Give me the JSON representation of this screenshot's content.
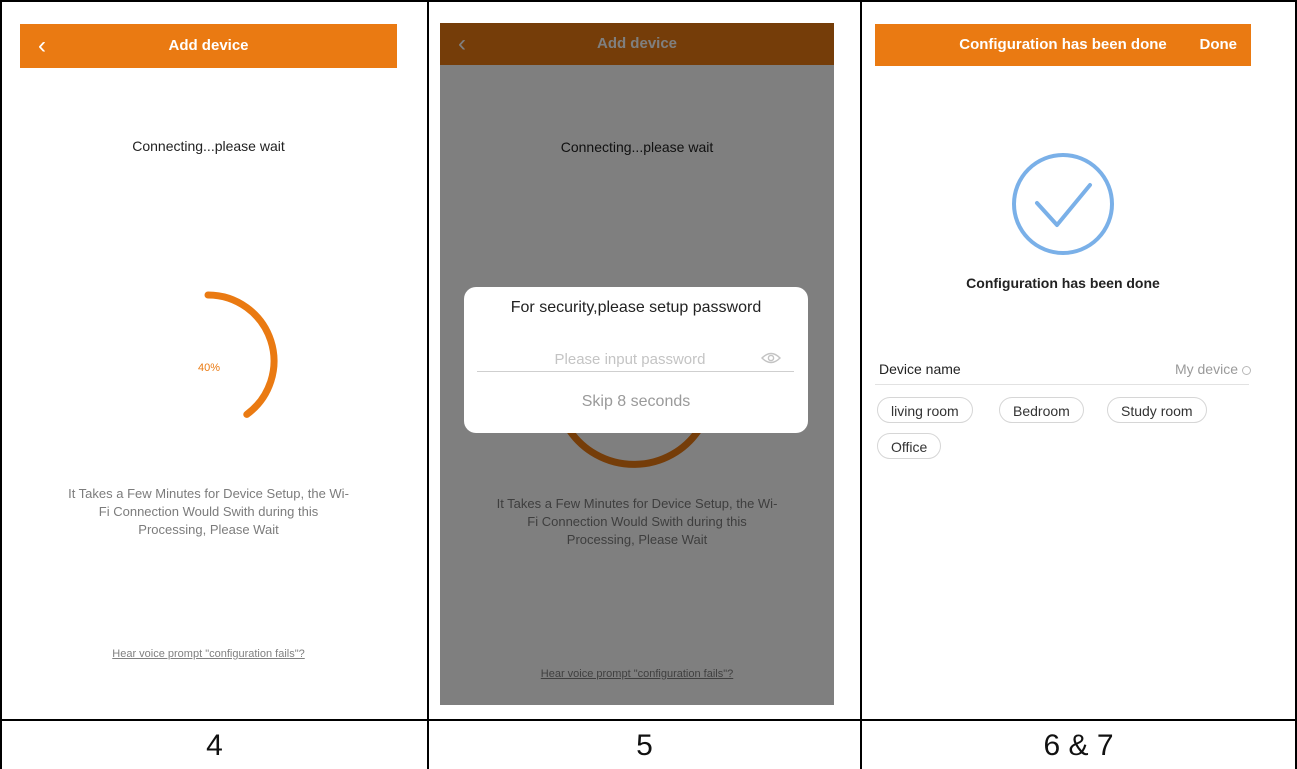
{
  "screens": [
    {
      "header": {
        "back_glyph": "‹",
        "title": "Add device"
      },
      "status": "Connecting...please wait",
      "progress": {
        "percent_label": "40%",
        "value": 0.4,
        "color": "#ea7a12"
      },
      "hint_lines": [
        "It Takes a Few Minutes for Device Setup, the Wi-",
        "Fi Connection Would Swith during this",
        "Processing, Please Wait"
      ],
      "help_link": "Hear voice prompt \"configuration fails\"?"
    },
    {
      "header": {
        "back_glyph": "‹",
        "title": "Add device"
      },
      "status": "Connecting...please wait",
      "hint_lines": [
        "It Takes a Few Minutes for Device Setup, the Wi-",
        "Fi Connection Would Swith during this",
        "Processing, Please Wait"
      ],
      "help_link": "Hear voice prompt \"configuration fails\"?",
      "modal": {
        "title": "For security,please setup password",
        "password_placeholder": "Please input password",
        "skip_label": "Skip 8 seconds"
      }
    },
    {
      "header": {
        "title": "Configuration has been done",
        "done_label": "Done"
      },
      "done_title": "Configuration has been done",
      "device_name_label": "Device name",
      "device_name_value": "My device",
      "rooms": [
        "living room",
        "Bedroom",
        "Study room",
        "Office"
      ],
      "check_color": "#7ab0e8"
    }
  ],
  "captions": [
    "4",
    "5",
    "6 & 7"
  ],
  "colors": {
    "accent": "#ea7a12",
    "check": "#7ab0e8"
  }
}
